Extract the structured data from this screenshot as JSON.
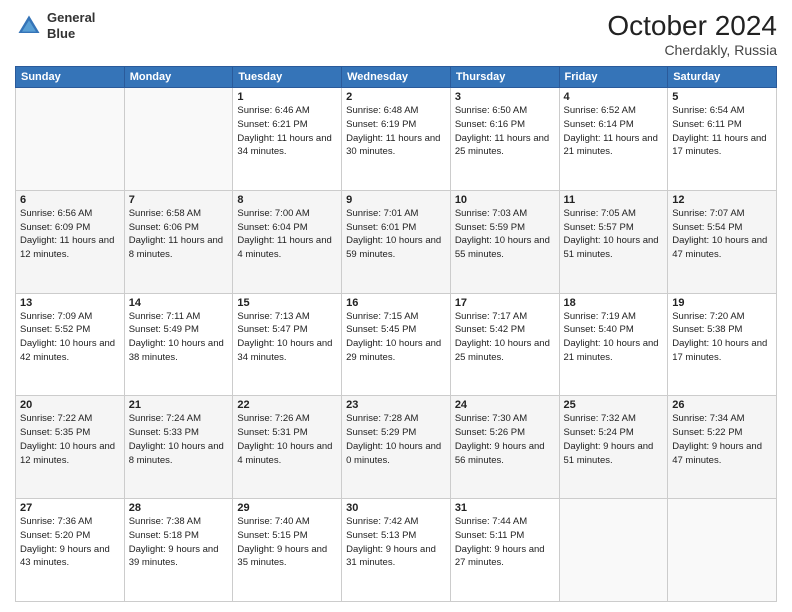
{
  "header": {
    "logo_line1": "General",
    "logo_line2": "Blue",
    "month_year": "October 2024",
    "location": "Cherdakly, Russia"
  },
  "days_of_week": [
    "Sunday",
    "Monday",
    "Tuesday",
    "Wednesday",
    "Thursday",
    "Friday",
    "Saturday"
  ],
  "weeks": [
    [
      {
        "num": "",
        "sunrise": "",
        "sunset": "",
        "daylight": ""
      },
      {
        "num": "",
        "sunrise": "",
        "sunset": "",
        "daylight": ""
      },
      {
        "num": "1",
        "sunrise": "Sunrise: 6:46 AM",
        "sunset": "Sunset: 6:21 PM",
        "daylight": "Daylight: 11 hours and 34 minutes."
      },
      {
        "num": "2",
        "sunrise": "Sunrise: 6:48 AM",
        "sunset": "Sunset: 6:19 PM",
        "daylight": "Daylight: 11 hours and 30 minutes."
      },
      {
        "num": "3",
        "sunrise": "Sunrise: 6:50 AM",
        "sunset": "Sunset: 6:16 PM",
        "daylight": "Daylight: 11 hours and 25 minutes."
      },
      {
        "num": "4",
        "sunrise": "Sunrise: 6:52 AM",
        "sunset": "Sunset: 6:14 PM",
        "daylight": "Daylight: 11 hours and 21 minutes."
      },
      {
        "num": "5",
        "sunrise": "Sunrise: 6:54 AM",
        "sunset": "Sunset: 6:11 PM",
        "daylight": "Daylight: 11 hours and 17 minutes."
      }
    ],
    [
      {
        "num": "6",
        "sunrise": "Sunrise: 6:56 AM",
        "sunset": "Sunset: 6:09 PM",
        "daylight": "Daylight: 11 hours and 12 minutes."
      },
      {
        "num": "7",
        "sunrise": "Sunrise: 6:58 AM",
        "sunset": "Sunset: 6:06 PM",
        "daylight": "Daylight: 11 hours and 8 minutes."
      },
      {
        "num": "8",
        "sunrise": "Sunrise: 7:00 AM",
        "sunset": "Sunset: 6:04 PM",
        "daylight": "Daylight: 11 hours and 4 minutes."
      },
      {
        "num": "9",
        "sunrise": "Sunrise: 7:01 AM",
        "sunset": "Sunset: 6:01 PM",
        "daylight": "Daylight: 10 hours and 59 minutes."
      },
      {
        "num": "10",
        "sunrise": "Sunrise: 7:03 AM",
        "sunset": "Sunset: 5:59 PM",
        "daylight": "Daylight: 10 hours and 55 minutes."
      },
      {
        "num": "11",
        "sunrise": "Sunrise: 7:05 AM",
        "sunset": "Sunset: 5:57 PM",
        "daylight": "Daylight: 10 hours and 51 minutes."
      },
      {
        "num": "12",
        "sunrise": "Sunrise: 7:07 AM",
        "sunset": "Sunset: 5:54 PM",
        "daylight": "Daylight: 10 hours and 47 minutes."
      }
    ],
    [
      {
        "num": "13",
        "sunrise": "Sunrise: 7:09 AM",
        "sunset": "Sunset: 5:52 PM",
        "daylight": "Daylight: 10 hours and 42 minutes."
      },
      {
        "num": "14",
        "sunrise": "Sunrise: 7:11 AM",
        "sunset": "Sunset: 5:49 PM",
        "daylight": "Daylight: 10 hours and 38 minutes."
      },
      {
        "num": "15",
        "sunrise": "Sunrise: 7:13 AM",
        "sunset": "Sunset: 5:47 PM",
        "daylight": "Daylight: 10 hours and 34 minutes."
      },
      {
        "num": "16",
        "sunrise": "Sunrise: 7:15 AM",
        "sunset": "Sunset: 5:45 PM",
        "daylight": "Daylight: 10 hours and 29 minutes."
      },
      {
        "num": "17",
        "sunrise": "Sunrise: 7:17 AM",
        "sunset": "Sunset: 5:42 PM",
        "daylight": "Daylight: 10 hours and 25 minutes."
      },
      {
        "num": "18",
        "sunrise": "Sunrise: 7:19 AM",
        "sunset": "Sunset: 5:40 PM",
        "daylight": "Daylight: 10 hours and 21 minutes."
      },
      {
        "num": "19",
        "sunrise": "Sunrise: 7:20 AM",
        "sunset": "Sunset: 5:38 PM",
        "daylight": "Daylight: 10 hours and 17 minutes."
      }
    ],
    [
      {
        "num": "20",
        "sunrise": "Sunrise: 7:22 AM",
        "sunset": "Sunset: 5:35 PM",
        "daylight": "Daylight: 10 hours and 12 minutes."
      },
      {
        "num": "21",
        "sunrise": "Sunrise: 7:24 AM",
        "sunset": "Sunset: 5:33 PM",
        "daylight": "Daylight: 10 hours and 8 minutes."
      },
      {
        "num": "22",
        "sunrise": "Sunrise: 7:26 AM",
        "sunset": "Sunset: 5:31 PM",
        "daylight": "Daylight: 10 hours and 4 minutes."
      },
      {
        "num": "23",
        "sunrise": "Sunrise: 7:28 AM",
        "sunset": "Sunset: 5:29 PM",
        "daylight": "Daylight: 10 hours and 0 minutes."
      },
      {
        "num": "24",
        "sunrise": "Sunrise: 7:30 AM",
        "sunset": "Sunset: 5:26 PM",
        "daylight": "Daylight: 9 hours and 56 minutes."
      },
      {
        "num": "25",
        "sunrise": "Sunrise: 7:32 AM",
        "sunset": "Sunset: 5:24 PM",
        "daylight": "Daylight: 9 hours and 51 minutes."
      },
      {
        "num": "26",
        "sunrise": "Sunrise: 7:34 AM",
        "sunset": "Sunset: 5:22 PM",
        "daylight": "Daylight: 9 hours and 47 minutes."
      }
    ],
    [
      {
        "num": "27",
        "sunrise": "Sunrise: 7:36 AM",
        "sunset": "Sunset: 5:20 PM",
        "daylight": "Daylight: 9 hours and 43 minutes."
      },
      {
        "num": "28",
        "sunrise": "Sunrise: 7:38 AM",
        "sunset": "Sunset: 5:18 PM",
        "daylight": "Daylight: 9 hours and 39 minutes."
      },
      {
        "num": "29",
        "sunrise": "Sunrise: 7:40 AM",
        "sunset": "Sunset: 5:15 PM",
        "daylight": "Daylight: 9 hours and 35 minutes."
      },
      {
        "num": "30",
        "sunrise": "Sunrise: 7:42 AM",
        "sunset": "Sunset: 5:13 PM",
        "daylight": "Daylight: 9 hours and 31 minutes."
      },
      {
        "num": "31",
        "sunrise": "Sunrise: 7:44 AM",
        "sunset": "Sunset: 5:11 PM",
        "daylight": "Daylight: 9 hours and 27 minutes."
      },
      {
        "num": "",
        "sunrise": "",
        "sunset": "",
        "daylight": ""
      },
      {
        "num": "",
        "sunrise": "",
        "sunset": "",
        "daylight": ""
      }
    ]
  ]
}
